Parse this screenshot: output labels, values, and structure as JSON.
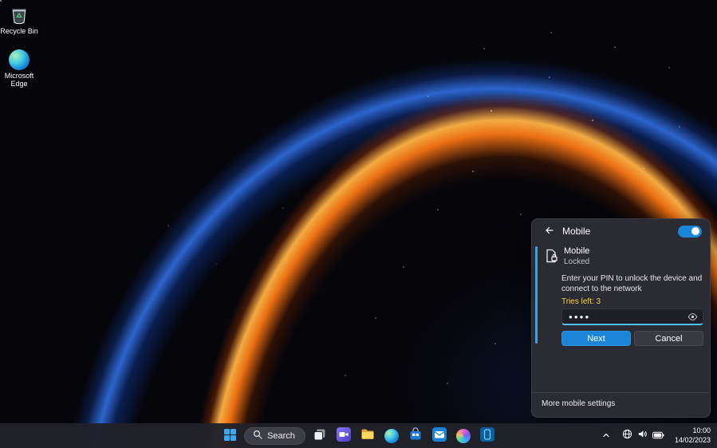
{
  "desktop": {
    "icons": [
      {
        "label": "Recycle Bin"
      },
      {
        "label": "Microsoft Edge"
      }
    ]
  },
  "mobile_panel": {
    "header": {
      "title": "Mobile",
      "toggle_state": "on"
    },
    "item": {
      "name": "Mobile",
      "status": "Locked"
    },
    "prompt": "Enter your PIN to unlock the device and connect to the network",
    "tries_left": "Tries left: 3",
    "pin": {
      "value": "●●●●"
    },
    "buttons": {
      "next": "Next",
      "cancel": "Cancel"
    },
    "footer_link": "More mobile settings"
  },
  "taskbar": {
    "search": {
      "label": "Search"
    },
    "icons": [
      "start-icon",
      "search-icon",
      "task-view-icon",
      "chat-icon",
      "file-explorer-icon",
      "edge-icon",
      "store-icon",
      "mail-icon",
      "photos-icon",
      "phone-link-icon",
      "chevron-up-icon",
      "network-globe-icon",
      "volume-icon",
      "battery-icon"
    ],
    "tray": {
      "time": "10:00",
      "date": "14/02/2023"
    }
  },
  "colors": {
    "accent": "#1b86d8",
    "accent_bright": "#4cc2ff",
    "warning": "#f6d33c",
    "panel_bg": "#2b2b33",
    "taskbar_bg": "#21212a"
  }
}
